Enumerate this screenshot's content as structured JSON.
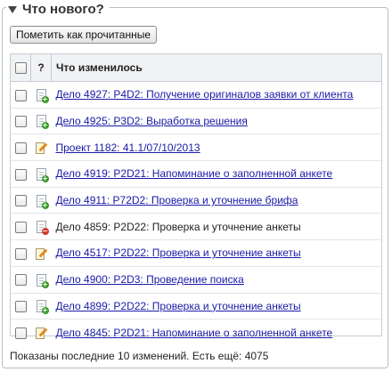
{
  "panel": {
    "title": "Что нового?"
  },
  "toolbar": {
    "mark_read_label": "Пометить как прочитанные"
  },
  "table": {
    "headers": {
      "status": "?",
      "change": "Что изменилось"
    },
    "rows": [
      {
        "text": "Дело 4927: P4D2: Получение оригиналов заявки от клиента",
        "icon": "document-add-icon",
        "link": true
      },
      {
        "text": "Дело 4925: P3D2: Выработка решения",
        "icon": "document-add-icon",
        "link": true
      },
      {
        "text": "Проект 1182: 41.1/07/10/2013",
        "icon": "document-edit-icon",
        "link": true
      },
      {
        "text": "Дело 4919: P2D21: Напоминание о заполненной анкете",
        "icon": "document-add-icon",
        "link": true
      },
      {
        "text": "Дело 4911: P72D2: Проверка и уточнение брифа",
        "icon": "document-add-icon",
        "link": true
      },
      {
        "text": "Дело 4859: P2D22: Проверка и уточнение анкеты",
        "icon": "document-remove-icon",
        "link": false
      },
      {
        "text": "Дело 4517: P2D22: Проверка и уточнение анкеты",
        "icon": "document-edit-icon",
        "link": true
      },
      {
        "text": "Дело 4900: P2D3: Проведение поиска",
        "icon": "document-add-icon",
        "link": true
      },
      {
        "text": "Дело 4899: P2D22: Проверка и уточнение анкеты",
        "icon": "document-add-icon",
        "link": true
      },
      {
        "text": "Дело 4845: P2D21: Напоминание о заполненной анкете",
        "icon": "document-edit-icon",
        "link": true
      }
    ]
  },
  "footer": {
    "summary": "Показаны последние 10 изменений. Есть ещё: 4075"
  },
  "colors": {
    "link": "#1a1aa8",
    "header_bg": "#f0f2f4",
    "border": "#c4ccd4"
  }
}
